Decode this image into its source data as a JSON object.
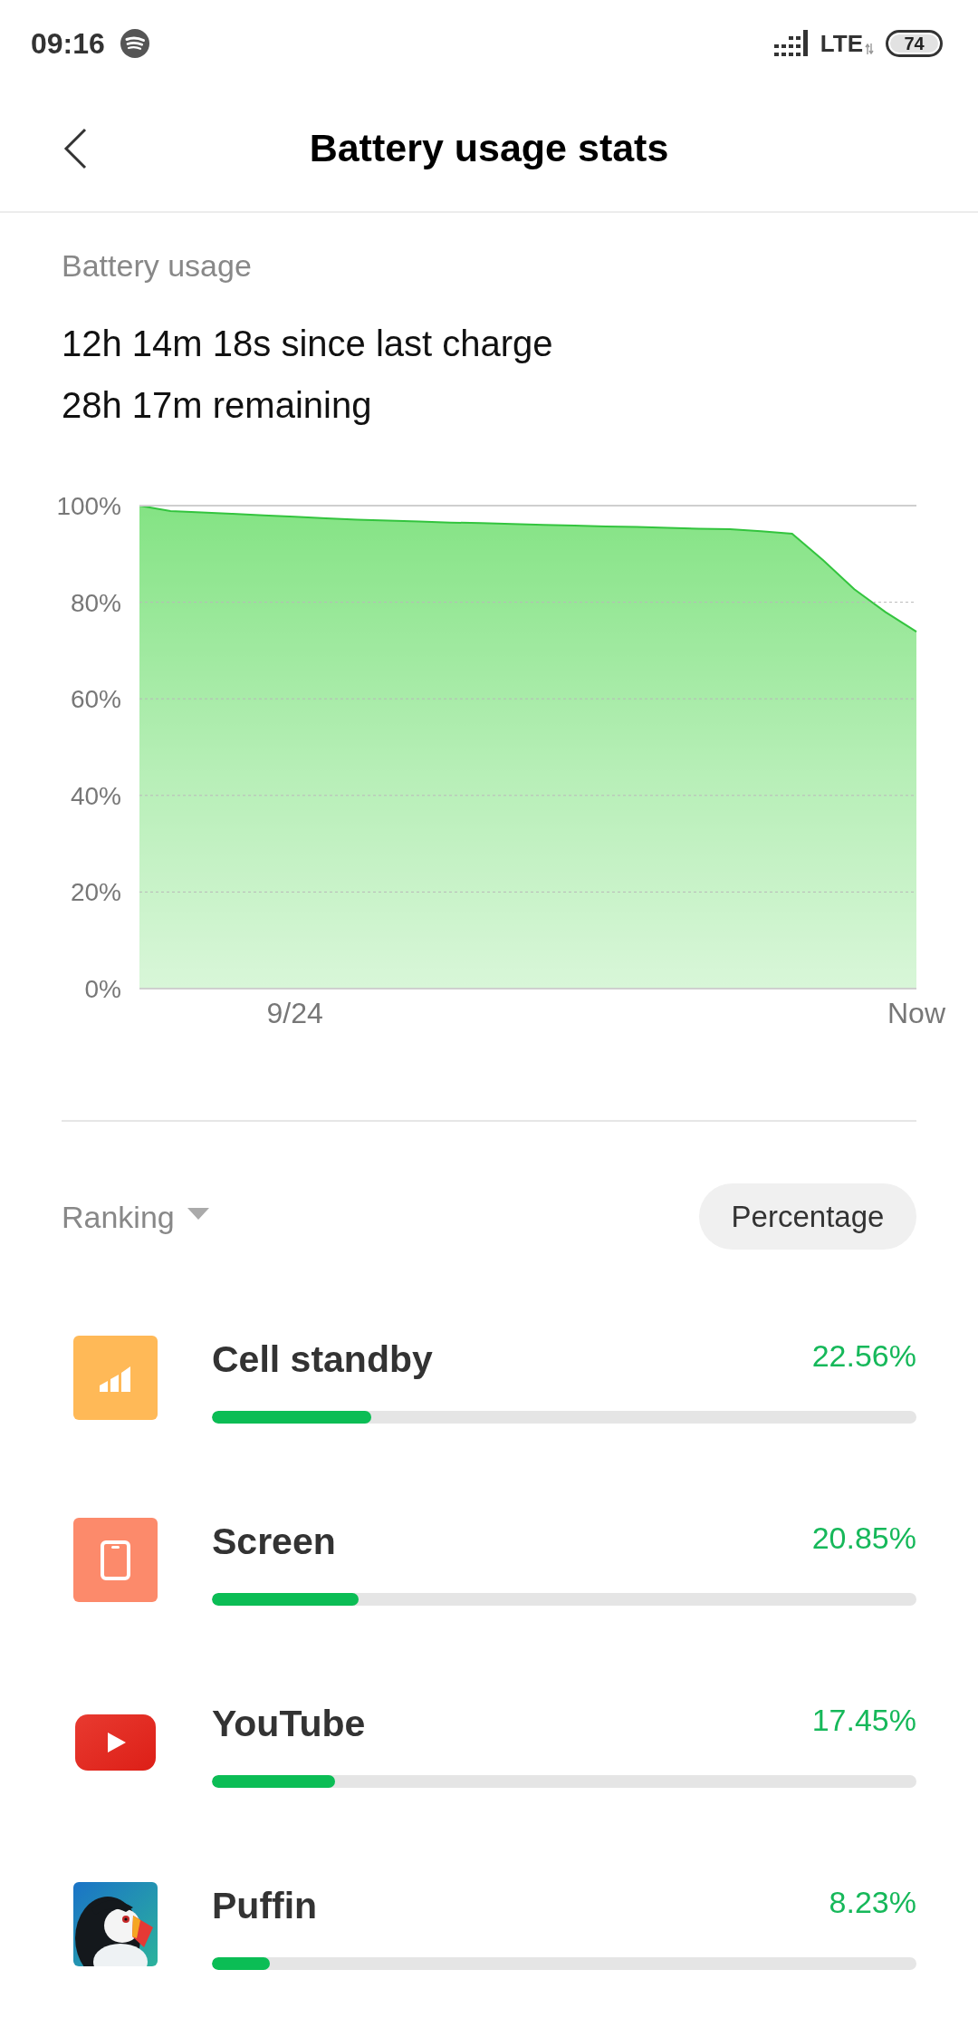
{
  "status_bar": {
    "time": "09:16",
    "network": "LTE",
    "battery": "74"
  },
  "header": {
    "title": "Battery usage stats"
  },
  "summary": {
    "label": "Battery usage",
    "since_charge": "12h 14m 18s since last charge",
    "remaining": "28h 17m remaining"
  },
  "chart": {
    "chart_data": {
      "type": "area",
      "categories": [
        null,
        null,
        null,
        null,
        null,
        "9/24",
        null,
        null,
        null,
        null,
        null,
        null,
        null,
        null,
        null,
        null,
        null,
        null,
        null,
        null,
        null,
        null,
        null,
        null,
        null,
        "Now"
      ],
      "values": [
        100,
        98.9,
        98.6,
        98.3,
        98.0,
        97.7,
        97.4,
        97.1,
        96.9,
        96.7,
        96.5,
        96.4,
        96.2,
        96.0,
        95.9,
        95.7,
        95.6,
        95.4,
        95.2,
        95.1,
        94.7,
        94.2,
        88.7,
        82.7,
        78.0,
        73.9
      ],
      "ylim": [
        0,
        100
      ],
      "yticks": [
        {
          "value": 0,
          "label": "0%"
        },
        {
          "value": 20,
          "label": "20%"
        },
        {
          "value": 40,
          "label": "40%"
        },
        {
          "value": 60,
          "label": "60%"
        },
        {
          "value": 80,
          "label": "80%"
        },
        {
          "value": 100,
          "label": "100%"
        }
      ],
      "grid": true
    }
  },
  "ranking": {
    "sort_label": "Ranking",
    "mode_button": "Percentage"
  },
  "apps": [
    {
      "kind": "signal",
      "name": "Cell standby",
      "percent": "22.56%",
      "level": 0.2256
    },
    {
      "kind": "screen",
      "name": "Screen",
      "percent": "20.85%",
      "level": 0.2085
    },
    {
      "kind": "play",
      "name": "YouTube",
      "percent": "17.45%",
      "level": 0.1745
    },
    {
      "kind": "puffin",
      "name": "Puffin",
      "percent": "8.23%",
      "level": 0.0823
    }
  ]
}
